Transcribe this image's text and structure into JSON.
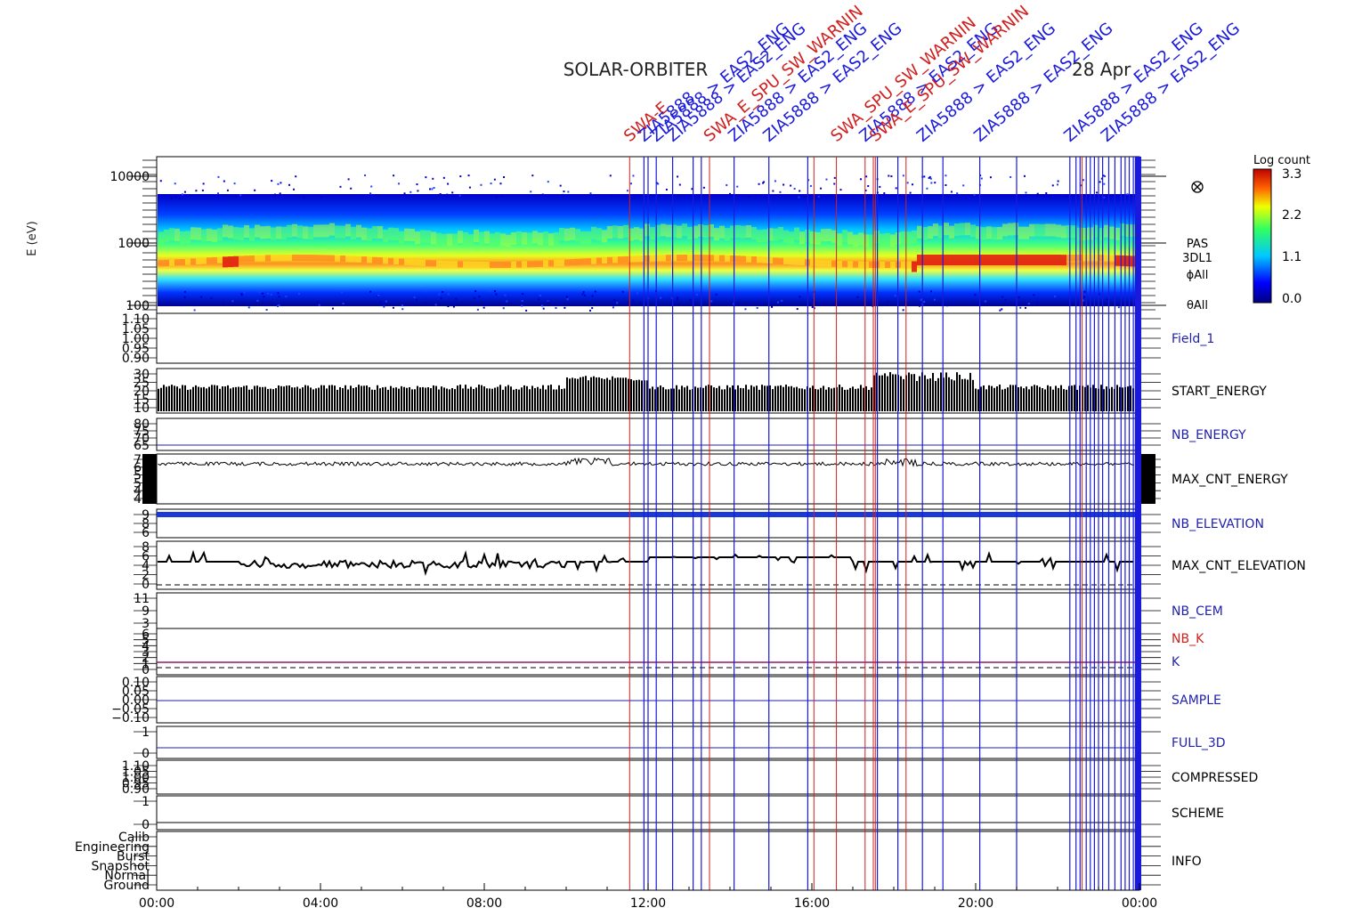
{
  "title": "SOLAR-ORBITER",
  "date_label": "28 Apr",
  "colors": {
    "event_blue": "#1a1adc",
    "event_red": "#d02020",
    "panel_blue_label": "#1f1fb0",
    "panel_red_label": "#d02020",
    "trace": "#000000",
    "elevation_band": "#1a3ad8"
  },
  "colorbar": {
    "title": "Log count",
    "ticks": [
      "3.3",
      "2.2",
      "1.1",
      "0.0"
    ]
  },
  "spectrogram": {
    "ylabel": "E (eV)",
    "yticks": [
      "10000",
      "1000",
      "100"
    ],
    "side_labels": [
      "PAS",
      "3DL1",
      "ϕAll",
      "θAll"
    ],
    "icon": "circle-cross-icon"
  },
  "x_axis": {
    "ticks": [
      "00:00",
      "04:00",
      "08:00",
      "12:00",
      "16:00",
      "20:00",
      "00:00"
    ]
  },
  "event_labels": [
    {
      "text": "SWA-E",
      "color": "red"
    },
    {
      "text": "ZIA5888",
      "color": "blue"
    },
    {
      "text": "ZIA5888 > EAS2_ENG",
      "color": "blue"
    },
    {
      "text": "ZIA5888 > EAS2_ENG",
      "color": "blue"
    },
    {
      "text": "SWA_E_SPU_SW_WARNIN",
      "color": "red"
    },
    {
      "text": "ZIA5888 > EAS2_ENG",
      "color": "blue"
    },
    {
      "text": "ZIA5888 > EAS2_ENG",
      "color": "blue"
    },
    {
      "text": "SWA_SPU_SW_WARNIN",
      "color": "red"
    },
    {
      "text": "ZIA5888 > EAS2_ENG",
      "color": "blue"
    },
    {
      "text": "SWA_E_SPU_SW_WARNIN",
      "color": "red"
    },
    {
      "text": "ZIA5888 > EAS2_ENG",
      "color": "blue"
    },
    {
      "text": "ZIA5888 > EAS2_ENG",
      "color": "blue"
    },
    {
      "text": "ZIA5888 > EAS2_ENG",
      "color": "blue"
    },
    {
      "text": "ZIA5888 > EAS2_ENG",
      "color": "blue"
    }
  ],
  "panels": [
    {
      "label": "Field_1",
      "label_color": "blue",
      "yticks": [
        "1.10",
        "1.05",
        "1.00",
        "0.95",
        "0.90"
      ]
    },
    {
      "label": "START_ENERGY",
      "label_color": "black",
      "yticks": [
        "30",
        "25",
        "20",
        "15",
        "10"
      ]
    },
    {
      "label": "NB_ENERGY",
      "label_color": "blue",
      "yticks": [
        "80",
        "75",
        "70",
        "65"
      ]
    },
    {
      "label": "MAX_CNT_ENERGY",
      "label_color": "black",
      "yticks": [
        "70",
        "60",
        "55",
        "50",
        "45",
        "40"
      ]
    },
    {
      "label": "NB_ELEVATION",
      "label_color": "blue",
      "yticks": [
        "9",
        "8",
        "6"
      ]
    },
    {
      "label": "MAX_CNT_ELEVATION",
      "label_color": "black",
      "yticks": [
        "8",
        "6",
        "4",
        "2",
        "0"
      ]
    },
    {
      "label": "NB_CEM",
      "label_color": "blue",
      "yticks": [
        "11",
        "9",
        "3"
      ]
    },
    {
      "label": "NB_K",
      "label_color": "red",
      "yticks": [
        "6",
        "5",
        "4",
        "3",
        "2",
        "1",
        "0"
      ],
      "extra_label": "K",
      "extra_label_color": "blue"
    },
    {
      "label": "SAMPLE",
      "label_color": "blue",
      "yticks": [
        "0.10",
        "0.05",
        "0.00",
        "−0.05",
        "−0.10"
      ]
    },
    {
      "label": "FULL_3D",
      "label_color": "blue",
      "yticks": [
        "1",
        "0"
      ]
    },
    {
      "label": "COMPRESSED",
      "label_color": "black",
      "yticks": [
        "1.10",
        "1.05",
        "1.00",
        "0.95",
        "0.90"
      ]
    },
    {
      "label": "SCHEME",
      "label_color": "black",
      "yticks": [
        "1",
        "0"
      ]
    },
    {
      "label": "INFO",
      "label_color": "black",
      "yticks": [
        "Calib",
        "Engineering",
        "Burst",
        "Snapshot",
        "Normal",
        "Ground"
      ]
    }
  ],
  "chart_data": {
    "type": "heatmap",
    "title": "SOLAR-ORBITER",
    "xlabel": "",
    "ylabel": "E (eV)",
    "ylim": [
      100,
      15000
    ],
    "y_scale": "log",
    "xlim_hours": [
      0,
      24
    ],
    "colorbar_range": [
      0.0,
      3.3
    ],
    "colorbar_label": "Log count",
    "event_markers": {
      "blue_hours": [
        11.9,
        12.0,
        12.2,
        12.6,
        13.1,
        13.3,
        14.1,
        14.95,
        15.9,
        17.6,
        18.1,
        18.7,
        19.2,
        20.1,
        21.0,
        22.3,
        22.45,
        22.55,
        22.7,
        22.8,
        22.9,
        23.0,
        23.1,
        23.25,
        23.4,
        23.55,
        23.65,
        23.75,
        23.85,
        23.9
      ],
      "red_hours": [
        11.55,
        13.5,
        16.05,
        16.6,
        17.3,
        17.5,
        17.55,
        18.3,
        22.6
      ]
    },
    "peak_energy_band_eV": [
      400,
      700
    ]
  }
}
